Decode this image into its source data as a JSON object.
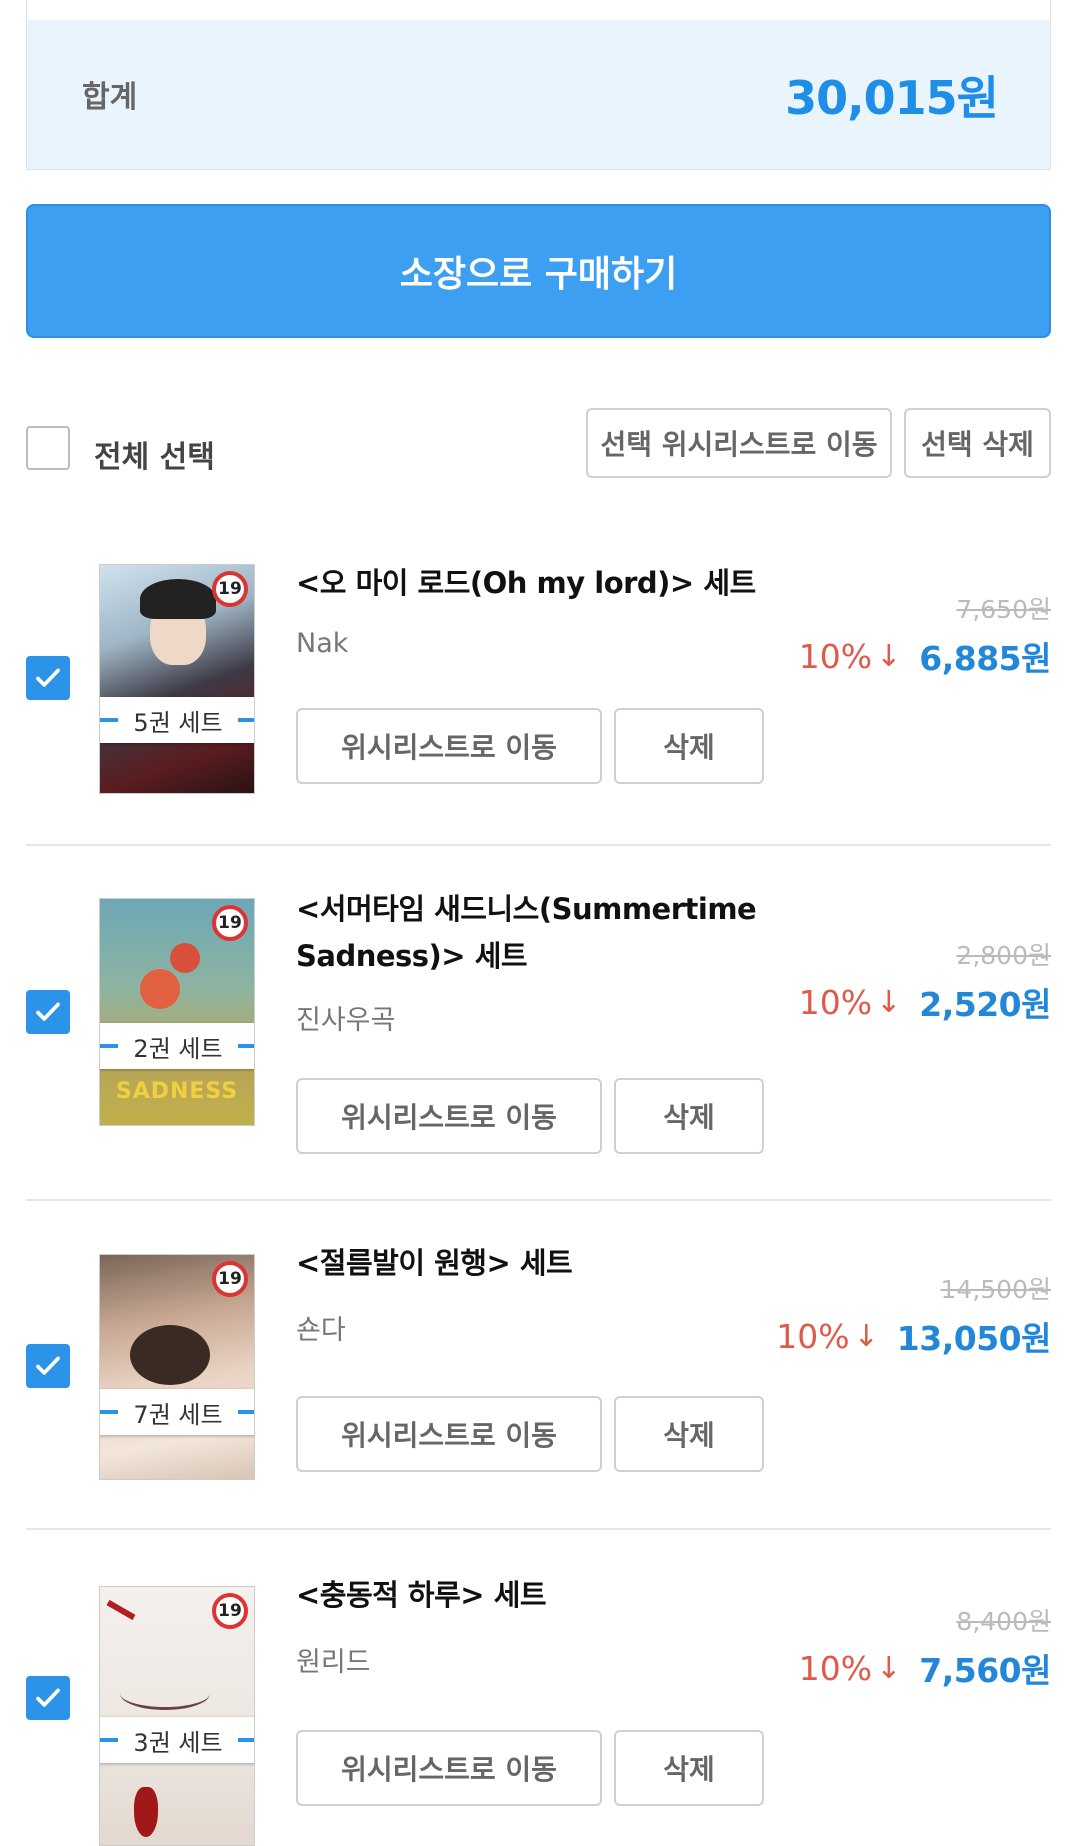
{
  "total": {
    "label": "합계",
    "value": "30,015원"
  },
  "buy_button": "소장으로 구매하기",
  "select_all": {
    "label": "전체 선택",
    "checked": false
  },
  "bulk_actions": {
    "move_to_wishlist": "선택 위시리스트로 이동",
    "delete": "선택 삭제"
  },
  "colors": {
    "accent": "#3d9ff2",
    "price_blue": "#2387d8",
    "discount_red": "#e05a4a"
  },
  "items": [
    {
      "title": "<오 마이 로드(Oh my lord)> 세트",
      "author": "Nak",
      "set_count": "5권 세트",
      "rating_badge": "19",
      "original_price": "7,650원",
      "discount": "10%",
      "final_price": "6,885원",
      "checked": true,
      "wishlist_btn": "위시리스트로 이동",
      "delete_btn": "삭제"
    },
    {
      "title": "<서머타임 새드니스(Summertime Sadness)> 세트",
      "author": "진사우곡",
      "set_count": "2권 세트",
      "rating_badge": "19",
      "cover_text": "SADNESS",
      "original_price": "2,800원",
      "discount": "10%",
      "final_price": "2,520원",
      "checked": true,
      "wishlist_btn": "위시리스트로 이동",
      "delete_btn": "삭제"
    },
    {
      "title": "<절름발이 원행> 세트",
      "author": "숀다",
      "set_count": "7권 세트",
      "rating_badge": "19",
      "original_price": "14,500원",
      "discount": "10%",
      "final_price": "13,050원",
      "checked": true,
      "wishlist_btn": "위시리스트로 이동",
      "delete_btn": "삭제"
    },
    {
      "title": "<충동적 하루> 세트",
      "author": "원리드",
      "set_count": "3권 세트",
      "rating_badge": "19",
      "original_price": "8,400원",
      "discount": "10%",
      "final_price": "7,560원",
      "checked": true,
      "wishlist_btn": "위시리스트로 이동",
      "delete_btn": "삭제"
    }
  ]
}
